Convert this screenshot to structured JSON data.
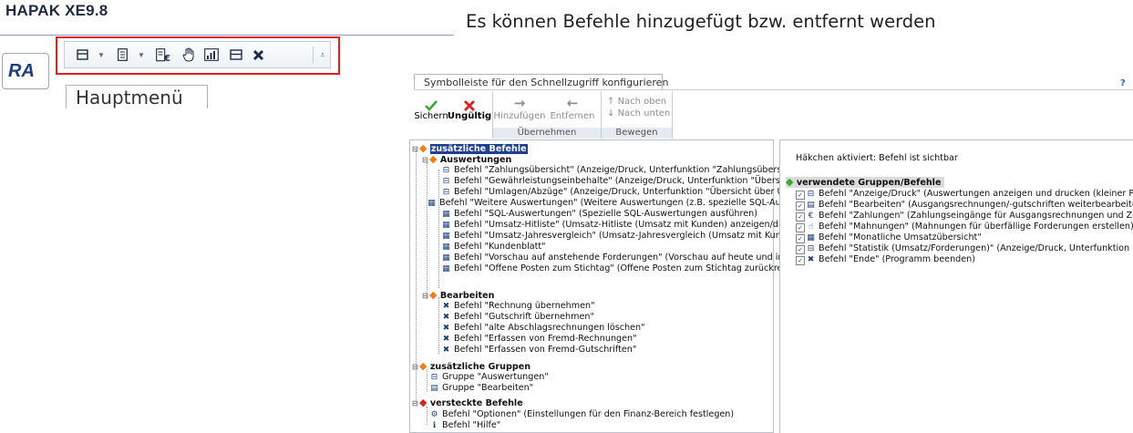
{
  "app": {
    "title": "HAPAK XE9.8",
    "logo_text": "RA",
    "main_menu_tab": "Hauptmenü"
  },
  "quick_access_toolbar": {
    "icons": [
      "print-icon",
      "dropdown-arrow-icon",
      "document-icon",
      "dropdown-arrow-icon",
      "euro-document-icon",
      "reminder-hand-icon",
      "monthly-chart-icon",
      "print-icon",
      "close-x-icon",
      "customize-toolbar-icon"
    ],
    "highlight_color": "#e0211f"
  },
  "caption": "Es können Befehle hinzugefügt bzw. entfernt werden",
  "dialog": {
    "title": "Symbolleiste für den Schnellzugriff konfigurieren",
    "help": "?",
    "ribbon": {
      "save": "Sichern",
      "invalid": "Ungültig",
      "add": "Hinzufügen",
      "remove": "Entfernen",
      "up": "Nach oben",
      "down": "Nach unten",
      "group_apply": "Übernehmen",
      "group_move": "Bewegen"
    },
    "left_tree": {
      "root": "zusätzliche Befehle",
      "auswertungen_group": "Auswertungen",
      "auswertungen": [
        "Befehl \"Zahlungsübersicht\" (Anzeige/Druck, Unterfunktion \"Zahlungsübersicht\")",
        "Befehl \"Gewährleistungseinbehalte\" (Anzeige/Druck, Unterfunktion \"Übersicht üb",
        "Befehl \"Umlagen/Abzüge\" (Anzeige/Druck, Unterfunktion \"Übersicht über Umlage",
        "Befehl \"Weitere Auswertungen\" (Weitere Auswertungen (z.B. spezielle SQL-Auswe",
        "Befehl \"SQL-Auswertungen\" (Spezielle SQL-Auswertungen ausführen)",
        "Befehl \"Umsatz-Hitliste\" (Umsatz-Hitliste (Umsatz mit Kunden) anzeigen/drucken)",
        "Befehl \"Umsatz-Jahresvergleich\" (Umsatz-Jahresvergleich (Umsatz mit Kunden) f",
        "Befehl \"Kundenblatt\"",
        "Befehl \"Vorschau auf anstehende Forderungen\" (Vorschau auf heute und in den",
        "Befehl \"Offene Posten zum Stichtag\" (Offene Posten zum Stichtag zurückrechne"
      ],
      "bearbeiten_group": "Bearbeiten",
      "bearbeiten": [
        "Befehl \"Rechnung übernehmen\"",
        "Befehl \"Gutschrift übernehmen\"",
        "Befehl \"alte Abschlagsrechnungen löschen\"",
        "Befehl \"Erfassen von Fremd-Rechnungen\"",
        "Befehl \"Erfassen von Fremd-Gutschriften\""
      ],
      "extra_groups": "zusätzliche Gruppen",
      "extra_group_items": [
        "Gruppe \"Auswertungen\"",
        "Gruppe \"Bearbeiten\""
      ],
      "hidden": "versteckte Befehle",
      "hidden_items": [
        "Befehl \"Optionen\" (Einstellungen für den Finanz-Bereich festlegen)",
        "Befehl \"Hilfe\""
      ]
    },
    "right_panel": {
      "hint": "Häkchen aktiviert: Befehl ist sichtbar",
      "group": "verwendete Gruppen/Befehle",
      "items": [
        "Befehl \"Anzeige/Druck\" (Auswertungen anzeigen und drucken (kleiner Pfeil: dir",
        "Befehl \"Bearbeiten\" (Ausgangsrechnungen/-gutschriften weiterbearbeiten)",
        "Befehl \"Zahlungen\" (Zahlungseingänge für Ausgangsrechnungen und Zahlung",
        "Befehl \"Mahnungen\" (Mahnungen für überfällige Forderungen erstellen)",
        "Befehl \"Monatliche Umsatzübersicht\"",
        "Befehl \"Statistik (Umsatz/Forderungen)\" (Anzeige/Druck, Unterfunktion \"Statis",
        "Befehl \"Ende\" (Programm beenden)"
      ]
    }
  }
}
